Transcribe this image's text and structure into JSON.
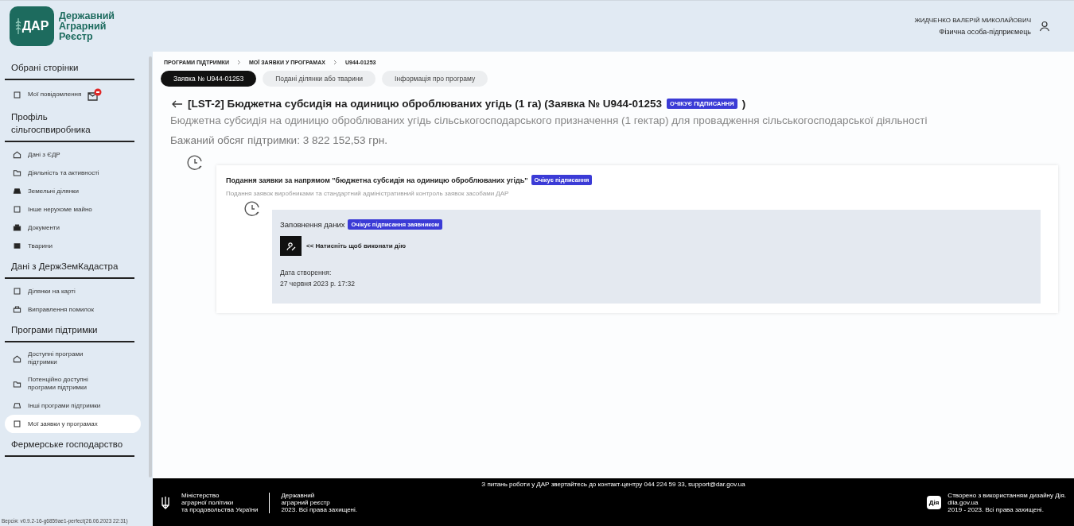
{
  "logo": {
    "mark": "ДАР",
    "lines": [
      "Державний",
      "Аграрний",
      "Реєстр"
    ]
  },
  "user": {
    "name": "ЖИДЧЕНКО ВАЛЕРІЙ МИКОЛАЙОВИЧ",
    "role": "Фізична особа-підприємець"
  },
  "sidebar": {
    "sections": [
      {
        "title": "Обрані сторінки",
        "items": [
          {
            "label": "Мої повідомлення",
            "selected": false,
            "has_notification": true
          }
        ]
      },
      {
        "title": "Профіль сільгоспвиробника",
        "items": [
          {
            "label": "Дані з ЄДР",
            "selected": false
          },
          {
            "label": "Діяльність та активності",
            "selected": false
          },
          {
            "label": "Земельні ділянки",
            "selected": false
          },
          {
            "label": "Інше нерухоме майно",
            "selected": false
          },
          {
            "label": "Документи",
            "selected": false
          },
          {
            "label": "Тварини",
            "selected": false
          }
        ]
      },
      {
        "title": "Дані з ДержЗемКадастра",
        "items": [
          {
            "label": "Ділянки на карті",
            "selected": false
          },
          {
            "label": "Виправлення помилок",
            "selected": false
          }
        ]
      },
      {
        "title": "Програми підтримки",
        "items": [
          {
            "label": "Доступні програми підтримки",
            "selected": false
          },
          {
            "label": "Потенційно доступні програми підтримки",
            "selected": false
          },
          {
            "label": "Інші програми підтримки",
            "selected": false
          },
          {
            "label": "Мої заявки у програмах",
            "selected": true
          }
        ]
      },
      {
        "title": "Фермерське господарство"
      }
    ],
    "version": "Версія: v0.9.2-16-g6859ae1-perfect(26.06.2023 22:31)"
  },
  "breadcrumbs": [
    "ПРОГРАМИ ПІДТРИМКИ",
    "МОЇ ЗАЯВКИ У ПРОГРАМАХ",
    "U944-01253"
  ],
  "tabs": [
    {
      "label": "Заявка № U944-01253",
      "selected": true
    },
    {
      "label": "Подані ділянки або тварини",
      "selected": false
    },
    {
      "label": "Інформація про програму",
      "selected": false
    }
  ],
  "application": {
    "title": "[LST-2] Бюджетна субсидія на одиницю оброблюваних угідь (1 га) (Заявка № U944-01253",
    "status": "ОЧІКУЄ ПІДПИСАННЯ",
    "title_end": ")",
    "description": "Бюджетна субсидія на одиницю оброблюваних угідь сільськогосподарського призначення (1 гектар) для провадження сільськогосподарської діяльності",
    "amount": "Бажаний обсяг підтримки: 3 822 152,53 грн."
  },
  "timeline": [
    {
      "title": "Подання заявки за напрямом \"бюджетна субсидія на одиницю оброблюваних угідь\"",
      "status": "Очікує підписання",
      "description": "Подання заявок виробниками та стандартний адміністративний контроль заявок засобами ДАР",
      "children": [
        {
          "title": "Заповнення даних",
          "status": "Очікує підписання заявником",
          "action": "<< Натисніть щоб виконати дію",
          "date_label": "Дата створення:",
          "date": "27 червня 2023 р. 17:32"
        }
      ]
    }
  ],
  "footer": {
    "contact": "З питань роботи у ДАР звертайтесь до контакт-центру 044 224 59 33, support@dar.gov.ua",
    "ministry": [
      "Міністерство",
      "аграрної політики",
      "та продовольства України"
    ],
    "registry": [
      "Державний",
      "аграрний реєстр",
      "2023. Всі права захищені."
    ],
    "diia_logo": "Дія",
    "diia": [
      "Створено з використанням дизайну Дія.",
      "diia.gov.ua",
      "2019 - 2023. Всі права захищені."
    ]
  }
}
